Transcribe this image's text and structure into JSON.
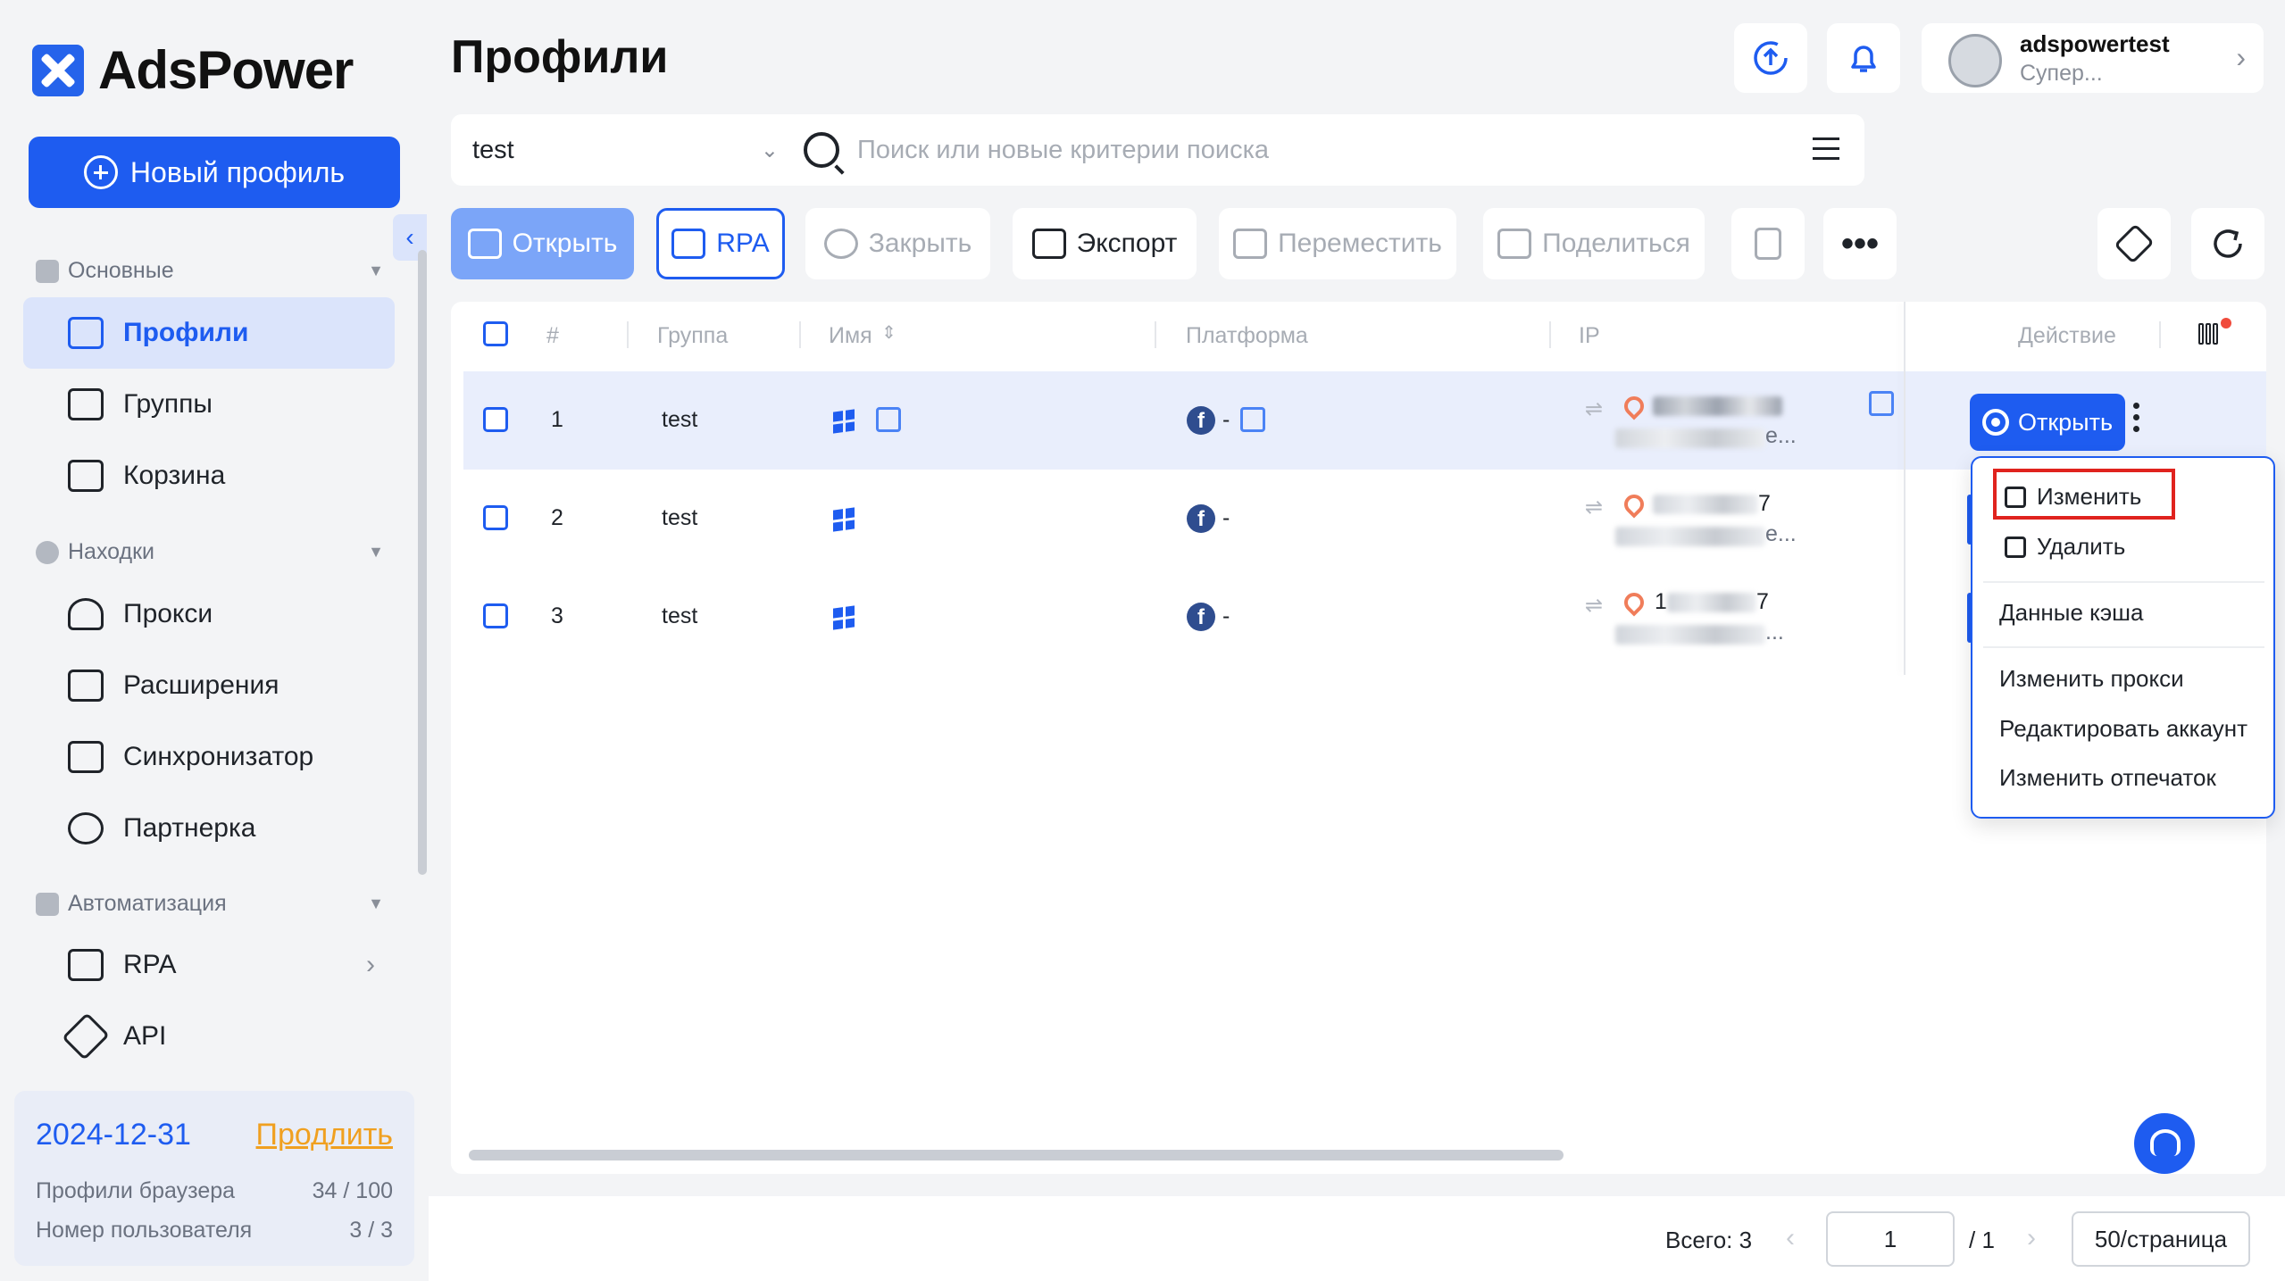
{
  "app": {
    "brand": "AdsPower",
    "brand_color": "#1e5cf0"
  },
  "sidebar": {
    "new_profile_label": "Новый профиль",
    "sections": [
      {
        "label": "Основные",
        "items": [
          {
            "label": "Профили",
            "icon": "profiles-icon",
            "active": true
          },
          {
            "label": "Группы",
            "icon": "folder-icon"
          },
          {
            "label": "Корзина",
            "icon": "trash-icon"
          }
        ]
      },
      {
        "label": "Находки",
        "items": [
          {
            "label": "Прокси",
            "icon": "proxy-icon"
          },
          {
            "label": "Расширения",
            "icon": "puzzle-icon"
          },
          {
            "label": "Синхронизатор",
            "icon": "sync-icon"
          },
          {
            "label": "Партнерка",
            "icon": "star-icon"
          }
        ]
      },
      {
        "label": "Автоматизация",
        "items": [
          {
            "label": "RPA",
            "icon": "robot-icon"
          },
          {
            "label": "API",
            "icon": "plug-icon"
          }
        ]
      }
    ],
    "subscription": {
      "date": "2024-12-31",
      "renew_label": "Продлить",
      "browser_profiles_label": "Профили браузера",
      "browser_profiles_value": "34 / 100",
      "users_label": "Номер пользователя",
      "users_value": "3 / 3"
    }
  },
  "header": {
    "title": "Профили",
    "user": {
      "name": "adspowertest",
      "role": "Супер..."
    }
  },
  "filters": {
    "group_value": "test",
    "search_placeholder": "Поиск или новые критерии поиска"
  },
  "toolbar": {
    "open": "Открыть",
    "rpa": "RPA",
    "close": "Закрыть",
    "export": "Экспорт",
    "move": "Переместить",
    "share": "Поделиться"
  },
  "table": {
    "columns": {
      "index": "#",
      "group": "Группа",
      "name": "Имя",
      "platform": "Платформа",
      "ip": "IP",
      "action": "Действие"
    },
    "rows": [
      {
        "index": "1",
        "group": "test",
        "platform_suffix": "-",
        "ip_suffix": "e...",
        "open_label": "Открыть"
      },
      {
        "index": "2",
        "group": "test",
        "platform_suffix": "-",
        "ip_tail": "7",
        "ip_suffix": "e..."
      },
      {
        "index": "3",
        "group": "test",
        "platform_suffix": "-",
        "ip_prefix": "1",
        "ip_tail": "7",
        "ip_suffix": "..."
      }
    ]
  },
  "context_menu": {
    "items": [
      "Изменить",
      "Удалить",
      "Данные кэша",
      "Изменить прокси",
      "Редактировать аккаунт",
      "Изменить отпечаток"
    ]
  },
  "pagination": {
    "total": "Всего: 3",
    "current_page": "1",
    "page_count": "/ 1",
    "per_page": "50/страница"
  }
}
